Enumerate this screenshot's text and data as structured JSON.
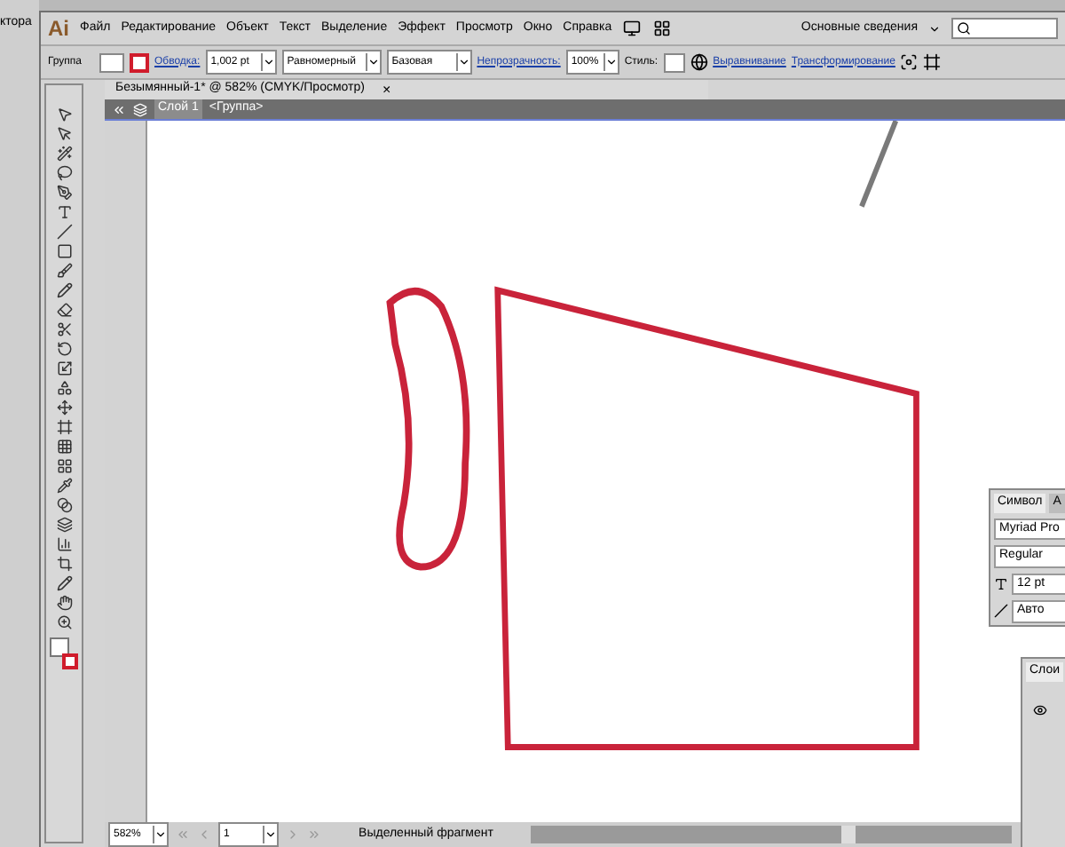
{
  "desktop_text": "ктора",
  "app": {
    "logo": "Ai",
    "menu": [
      "Файл",
      "Редактирование",
      "Объект",
      "Текст",
      "Выделение",
      "Эффект",
      "Просмотр",
      "Окно",
      "Справка"
    ],
    "workspace": "Основные сведения"
  },
  "control_bar": {
    "selection": "Группа",
    "stroke_link": "Обводка:",
    "stroke_weight": "1,002 pt",
    "profile": "Равномерный",
    "brush": "Базовая",
    "opacity_link": "Непрозрачность:",
    "opacity": "100%",
    "style_label": "Стиль:",
    "align_link": "Выравнивание",
    "transform_link": "Трансформирование"
  },
  "document_tab": {
    "title": "Безымянный-1* @ 582% (CMYK/Просмотр)",
    "close": "×"
  },
  "breadcrumb": [
    "Слой 1",
    "<Группа>"
  ],
  "status_bar": {
    "zoom": "582%",
    "artboard": "1",
    "info": "Выделенный фрагмент"
  },
  "character_panel": {
    "tabs": [
      {
        "label": "Символ",
        "selected": true
      },
      {
        "label": "A",
        "selected": false
      }
    ],
    "font": "Myriad Pro",
    "style": "Regular",
    "size": "12 pt",
    "tracking": "Авто"
  },
  "layers_panel": {
    "tabs": [
      {
        "label": "Слои",
        "selected": true
      }
    ]
  }
}
